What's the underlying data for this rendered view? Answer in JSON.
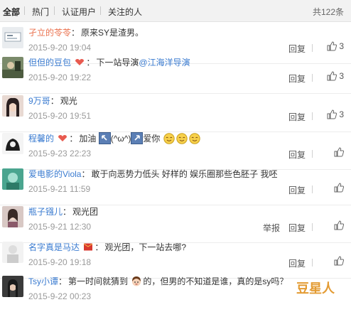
{
  "tabs": [
    {
      "label": "全部",
      "active": true
    },
    {
      "label": "热门",
      "active": false
    },
    {
      "label": "认证用户",
      "active": false
    },
    {
      "label": "关注的人",
      "active": false
    }
  ],
  "total": "共122条",
  "reply_label": "回复",
  "report_label": "举报",
  "comments": [
    {
      "user": "孑立的苓苓",
      "content": "原来SY是渣男。",
      "time": "2015-9-20 19:04",
      "likes": "3"
    },
    {
      "user": "但但的豆包",
      "pre": "下一站导演",
      "mention": "@江海洋导演",
      "time": "2015-9-20 19:22",
      "likes": "3"
    },
    {
      "user": "9万哥",
      "content": "观光",
      "time": "2015-9-20 19:51",
      "likes": "3"
    },
    {
      "user": "程馨的",
      "content_a": "加油",
      "content_b": "(^ω^)",
      "content_c": "爱你",
      "time": "2015-9-23 22:23",
      "likes": ""
    },
    {
      "user": "爱电影的Viola",
      "content": "敢于向恶势力低头 好样的 娱乐圈那些色胚子 我呸",
      "time": "2015-9-21 11:59",
      "likes": ""
    },
    {
      "user": "瓶子镪儿",
      "content": "观光团",
      "time": "2015-9-21 12:30",
      "likes": ""
    },
    {
      "user": "名字真是马达",
      "content": "观光团，下一站去哪?",
      "time": "2015-9-20 19:18",
      "likes": ""
    },
    {
      "user": "Tsy小谭",
      "pre": "第一时间就猜到",
      "post": "的，但男的不知道是谁，真的是sy吗？",
      "time": "2015-9-22 00:23",
      "likes": ""
    }
  ],
  "watermark": "豆星人",
  "colors": {
    "username": "#eb7350",
    "link": "#3a7bd0",
    "time": "#9a9a9a"
  }
}
